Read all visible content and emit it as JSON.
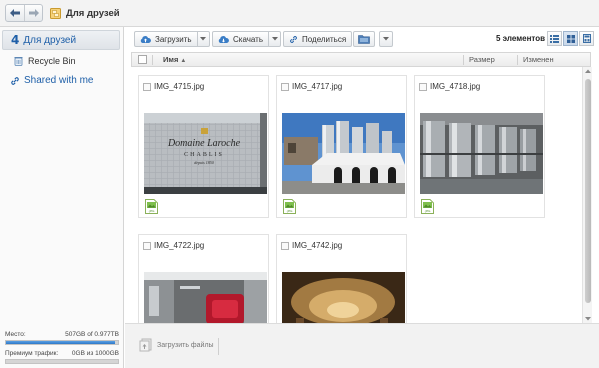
{
  "header": {
    "folder_title": "Для друзей"
  },
  "sidebar": {
    "active": {
      "number": "4",
      "label": "Для друзей"
    },
    "items": [
      {
        "label": "Recycle Bin"
      }
    ],
    "shared": {
      "label": "Shared with me"
    },
    "storage": {
      "label": "Место:",
      "value": "507GB of 0.977TB",
      "used_fraction": 0.97
    },
    "traffic": {
      "label": "Премиум трафик:",
      "value": "0GB из 1000GB",
      "used_fraction": 0.0
    }
  },
  "toolbar": {
    "upload_label": "Загрузить",
    "download_label": "Скачать",
    "share_label": "Поделиться",
    "count_text": "5 элементов"
  },
  "columns": {
    "name": "Имя",
    "size": "Размер",
    "modified": "Изменен"
  },
  "files": [
    {
      "name": "IMG_4715.jpg",
      "badge": ".JPG"
    },
    {
      "name": "IMG_4717.jpg",
      "badge": ".JPG"
    },
    {
      "name": "IMG_4718.jpg",
      "badge": ".JPG"
    },
    {
      "name": "IMG_4722.jpg",
      "badge": ".JPG"
    },
    {
      "name": "IMG_4742.jpg",
      "badge": ".JPG"
    }
  ],
  "photo_text": {
    "line1": "Domaine Laroche",
    "line2": "CHABLIS",
    "line3": "depuis 1850"
  },
  "bottombar": {
    "upload_files_label": "Загрузить файлы"
  },
  "colors": {
    "accent": "#1e5fa8",
    "bar_fill": "#2f79c8"
  }
}
